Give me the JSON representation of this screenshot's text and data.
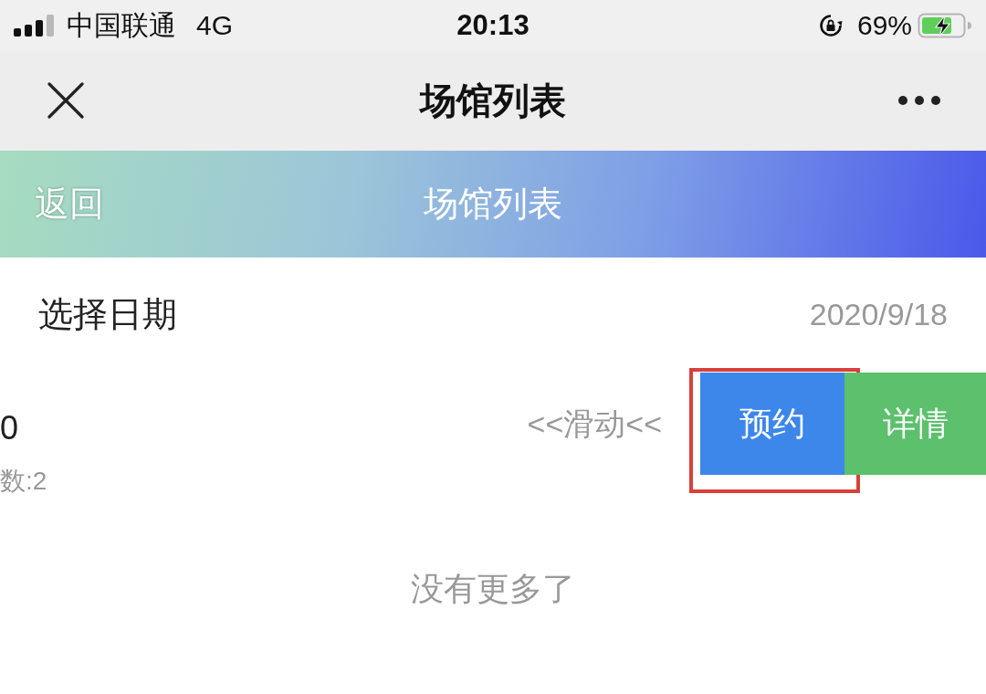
{
  "status_bar": {
    "carrier": "中国联通",
    "network": "4G",
    "time": "20:13",
    "battery": "69%"
  },
  "nav_bar": {
    "title": "场馆列表"
  },
  "header": {
    "back": "返回",
    "title": "场馆列表"
  },
  "date_row": {
    "label": "选择日期",
    "value": "2020/9/18"
  },
  "venue_row": {
    "line_1": "0",
    "line_2": "数:2",
    "hint": "<<滑动<<",
    "actions": [
      {
        "label": "预约",
        "kind": "book",
        "highlighted": true
      },
      {
        "label": "详情",
        "kind": "details",
        "highlighted": false
      }
    ]
  },
  "footer": "没有更多了"
}
